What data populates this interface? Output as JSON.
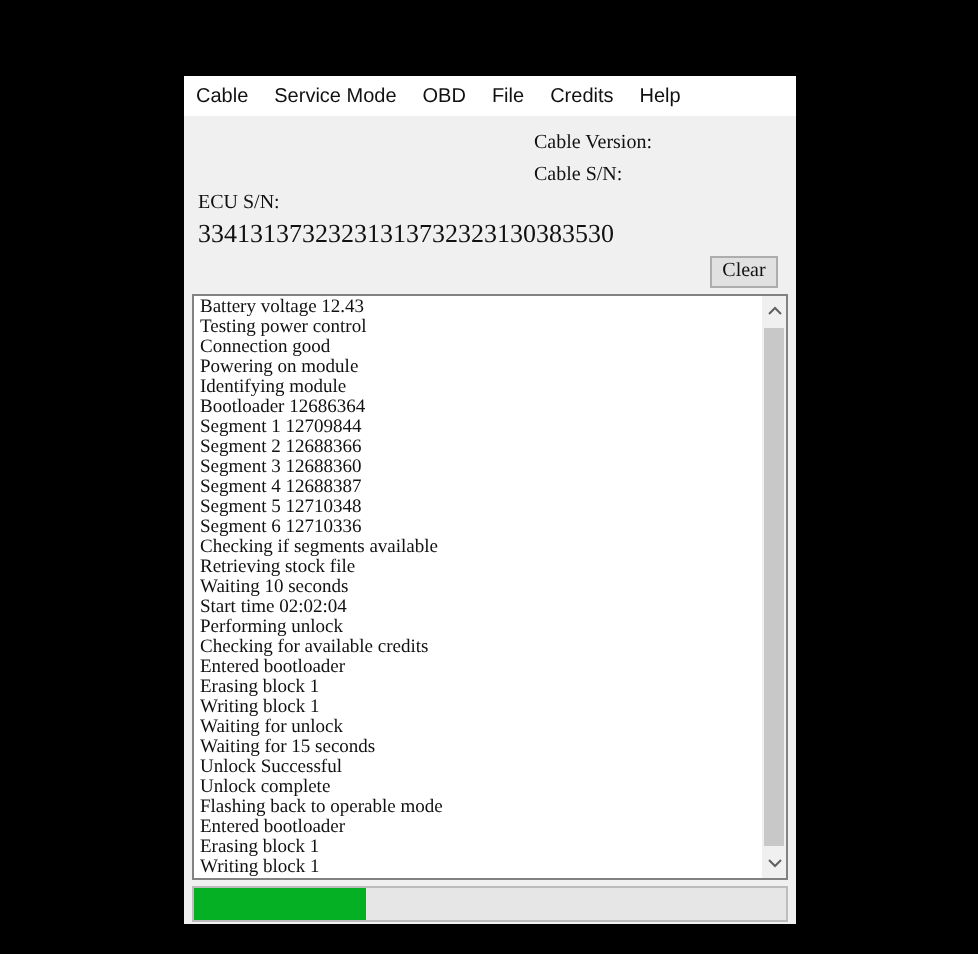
{
  "menu": [
    "Cable",
    "Service Mode",
    "OBD",
    "File",
    "Credits",
    "Help"
  ],
  "cable_version": {
    "label": "Cable Version:"
  },
  "cable_sn": {
    "label": "Cable S/N:"
  },
  "ecu_sn": {
    "label": "ECU S/N:",
    "value": "33413137323231313732323130383530"
  },
  "clear_button": "Clear",
  "log": [
    "Battery voltage 12.43",
    "Testing power control",
    "Connection good",
    "Powering on module",
    "Identifying module",
    "Bootloader 12686364",
    "Segment 1 12709844",
    "Segment 2 12688366",
    "Segment 3 12688360",
    "Segment 4 12688387",
    "Segment 5 12710348",
    "Segment 6 12710336",
    "Checking if segments available",
    "Retrieving stock file",
    "Waiting 10 seconds",
    "Start time 02:02:04",
    "Performing unlock",
    "Checking for available credits",
    "Entered bootloader",
    "Erasing block 1",
    "Writing block 1",
    "Waiting for unlock",
    "Waiting for 15 seconds",
    "Unlock Successful",
    "Unlock complete",
    "Flashing back to operable mode",
    "Entered bootloader",
    "Erasing block 1",
    "Writing block 1"
  ],
  "progress": {
    "level": 0.29
  }
}
